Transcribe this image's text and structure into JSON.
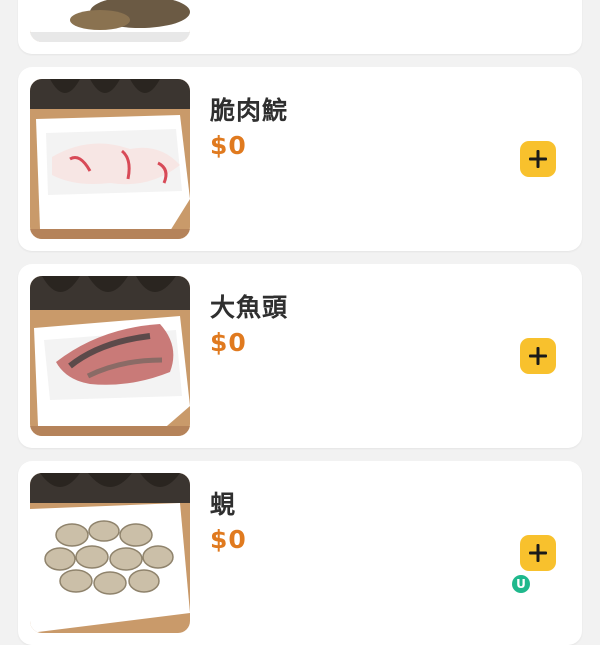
{
  "items": [
    {
      "name": "",
      "price": ""
    },
    {
      "name": "脆肉鯇",
      "price": "$0"
    },
    {
      "name": "大魚頭",
      "price": "$0"
    },
    {
      "name": "蜆",
      "price": "$0"
    }
  ],
  "icons": {
    "add": "plus-icon",
    "watermark": "u-logo-icon"
  },
  "colors": {
    "background": "#f2f2f2",
    "card": "#ffffff",
    "price": "#e07a1f",
    "add_button": "#f8c12d",
    "name": "#2f2f2f"
  },
  "watermark": {
    "letter": "U"
  }
}
